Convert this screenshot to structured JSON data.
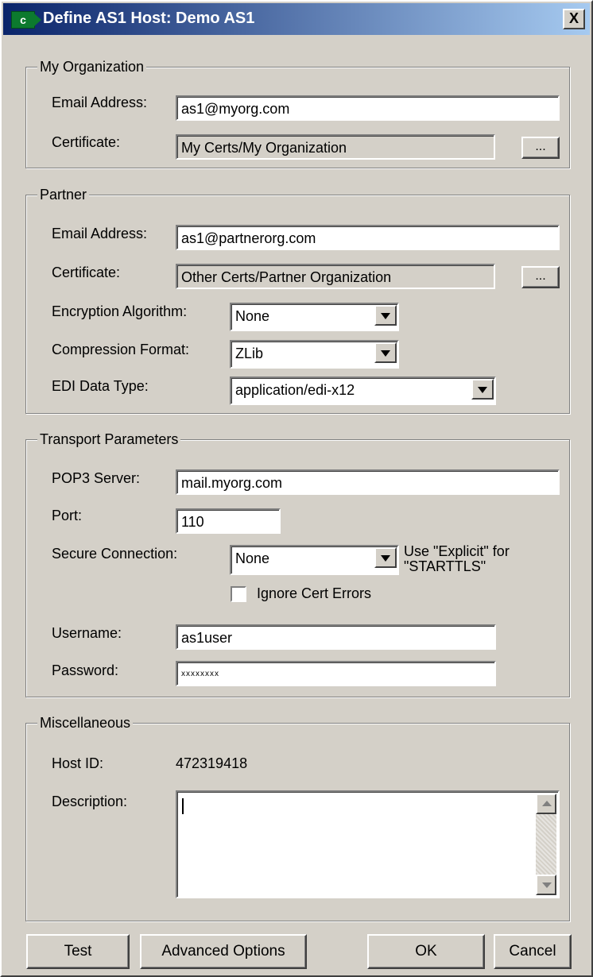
{
  "window": {
    "title": "Define AS1 Host: Demo AS1",
    "app_icon": "app-c-icon",
    "close_label": "X"
  },
  "my_org": {
    "title": "My Organization",
    "email_label": "Email Address:",
    "email_value": "as1@myorg.com",
    "cert_label": "Certificate:",
    "cert_value": "My Certs/My Organization",
    "browse_label": "..."
  },
  "partner": {
    "title": "Partner",
    "email_label": "Email Address:",
    "email_value": "as1@partnerorg.com",
    "cert_label": "Certificate:",
    "cert_value": "Other Certs/Partner Organization",
    "browse_label": "...",
    "enc_label": "Encryption Algorithm:",
    "enc_value": "None",
    "comp_label": "Compression Format:",
    "comp_value": "ZLib",
    "edi_label": "EDI Data Type:",
    "edi_value": "application/edi-x12"
  },
  "transport": {
    "title": "Transport Parameters",
    "pop3_label": "POP3 Server:",
    "pop3_value": "mail.myorg.com",
    "port_label": "Port:",
    "port_value": "110",
    "secure_label": "Secure Connection:",
    "secure_value": "None",
    "hint_line1": "Use \"Explicit\" for",
    "hint_line2": "\"STARTTLS\"",
    "ignore_label": "Ignore Cert Errors",
    "ignore_checked": false,
    "username_label": "Username:",
    "username_value": "as1user",
    "password_label": "Password:",
    "password_value": "xxxxxxxx"
  },
  "misc": {
    "title": "Miscellaneous",
    "hostid_label": "Host ID:",
    "hostid_value": "472319418",
    "desc_label": "Description:",
    "desc_value": ""
  },
  "buttons": {
    "test": "Test",
    "advanced": "Advanced Options",
    "ok": "OK",
    "cancel": "Cancel"
  }
}
